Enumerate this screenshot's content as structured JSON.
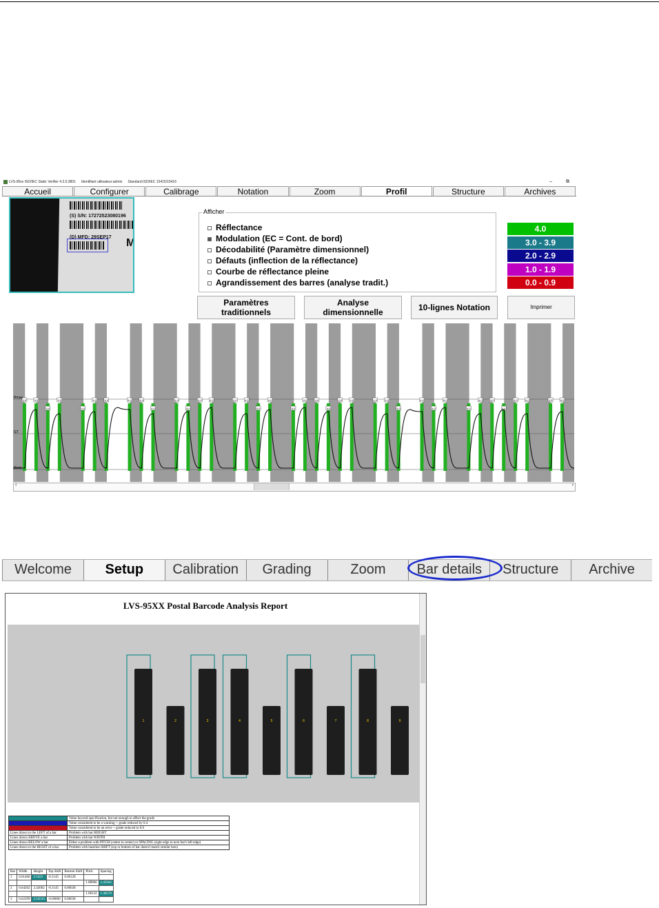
{
  "app1": {
    "title_parts": [
      "LVS-95xx ISO/IEC Static Verifier 4.3.0.3801",
      "Identifiant utilisateur:admin",
      "Standard:ISO/IEC 15415/15416"
    ],
    "window_buttons": [
      "–",
      "⧉"
    ],
    "tabs": [
      {
        "label": "Accueil",
        "active": false
      },
      {
        "label": "Configurer",
        "active": false
      },
      {
        "label": "Calibrage",
        "active": false
      },
      {
        "label": "Notation",
        "active": false
      },
      {
        "label": "Zoom",
        "active": false
      },
      {
        "label": "Profil",
        "active": true
      },
      {
        "label": "Structure",
        "active": false
      },
      {
        "label": "Archives",
        "active": false
      }
    ],
    "thumbnail": {
      "sn_text": "(S) S/N: 17272523080196",
      "mfd_text": "(D) MFD: 29SEP17",
      "letter": "M"
    },
    "afficher": {
      "legend": "Afficher",
      "options": [
        {
          "label": "Réflectance",
          "checked": false
        },
        {
          "label": "Modulation (EC = Cont. de bord)",
          "checked": true
        },
        {
          "label": "Décodabilité (Paramètre dimensionnel)",
          "checked": false
        },
        {
          "label": "Défauts (inflection de la réflectance)",
          "checked": false
        },
        {
          "label": "Courbe de réflectance pleine",
          "checked": false
        },
        {
          "label": "Agrandissement des barres (analyse tradit.)",
          "checked": false
        }
      ]
    },
    "grades": [
      {
        "label": "4.0",
        "color": "#00c000"
      },
      {
        "label": "3.0 - 3.9",
        "color": "#1a7a8a"
      },
      {
        "label": "2.0 - 2.9",
        "color": "#0a0a90"
      },
      {
        "label": "1.0 - 1.9",
        "color": "#c000c0"
      },
      {
        "label": "0.0 - 0.9",
        "color": "#d00010"
      }
    ],
    "buttons": {
      "traditional_l1": "Paramètres",
      "traditional_l2": "traditionnels",
      "dimensional_l1": "Analyse",
      "dimensional_l2": "dimensionnelle",
      "ten_lines": "10-lignes Notation",
      "print": "Imprimer"
    },
    "profile": {
      "ymax_label": "Rmax",
      "gt_label": "GT",
      "ymin_label": "Rmin",
      "bar_grade_label": "4.0",
      "bar_pattern": [
        1,
        0,
        1,
        0,
        1,
        1,
        0,
        1,
        0,
        0,
        1,
        0,
        1,
        1,
        0,
        1,
        0,
        1,
        1,
        0,
        1,
        0,
        1,
        1,
        0,
        1,
        0,
        1,
        0,
        1,
        1,
        0,
        1,
        0,
        0,
        1,
        0,
        1,
        1,
        0,
        1,
        0,
        1,
        0,
        1,
        1,
        0,
        1
      ]
    }
  },
  "app2": {
    "tabs": [
      {
        "label": "Welcome",
        "active": false
      },
      {
        "label": "Setup",
        "active": true
      },
      {
        "label": "Calibration",
        "active": false
      },
      {
        "label": "Grading",
        "active": false
      },
      {
        "label": "Zoom",
        "active": false
      },
      {
        "label": "Bar details",
        "active": false
      },
      {
        "label": "Structure",
        "active": false
      },
      {
        "label": "Archive",
        "active": false
      }
    ],
    "highlight_color": "#1a2acc",
    "report": {
      "title": "LVS-95XX Postal Barcode Analysis Report",
      "bars": [
        {
          "number": "1",
          "tall": true
        },
        {
          "number": "2",
          "tall": false
        },
        {
          "number": "3",
          "tall": true
        },
        {
          "number": "4",
          "tall": true
        },
        {
          "number": "5",
          "tall": false
        },
        {
          "number": "6",
          "tall": true
        },
        {
          "number": "7",
          "tall": false
        },
        {
          "number": "8",
          "tall": true
        },
        {
          "number": "9",
          "tall": false
        }
      ],
      "legend": [
        {
          "swatch": "#1a8a8a",
          "text": "Value beyond specification, but not enough to affect the grade"
        },
        {
          "swatch": "#1a1ab0",
          "text": "Value considered to be a warning -- grade reduced by 0.4"
        },
        {
          "swatch": "#c01020",
          "text": "Value considered to be an error -- grade reduced to 0.0"
        },
        {
          "swatch": "",
          "label": "Lines drawn to the LEFT of a bar",
          "text": "Problem with bar HEIGHT"
        },
        {
          "swatch": "",
          "label": "Lines drawn ABOVE a bar",
          "text": "Problem with bar WIDTH"
        },
        {
          "swatch": "",
          "label": "Lines drawn BELOW a bar",
          "text": "Either a problem with PITCH (center to center) or SPACING (right edge to next bar's left edge)"
        },
        {
          "swatch": "",
          "label": "Lines drawn to the RIGHT of a bar",
          "text": "Problem with baseline SHIFT (top or bottom of bar doesn't match similar bars)"
        }
      ],
      "detail_headers": [
        "Bar",
        "Width",
        "Height",
        "Top Shift",
        "Bottom Shift",
        "Pitch",
        "Spacing"
      ],
      "detail_rows": [
        [
          "1",
          "0.61460",
          "3.5425",
          "-0.1145",
          "0.06128",
          "",
          ""
        ],
        [
          "",
          "",
          "",
          "",
          "",
          "1.88966",
          "1.45942"
        ],
        [
          "2",
          "0.64262",
          "2.42062",
          "-0.1145",
          "0.06638",
          "",
          ""
        ],
        [
          "",
          "",
          "",
          "",
          "",
          "1.06132",
          "1.38579"
        ],
        [
          "3",
          "0.62299",
          "3.54510",
          "-0.06860",
          "0.06638",
          "",
          ""
        ]
      ]
    }
  }
}
